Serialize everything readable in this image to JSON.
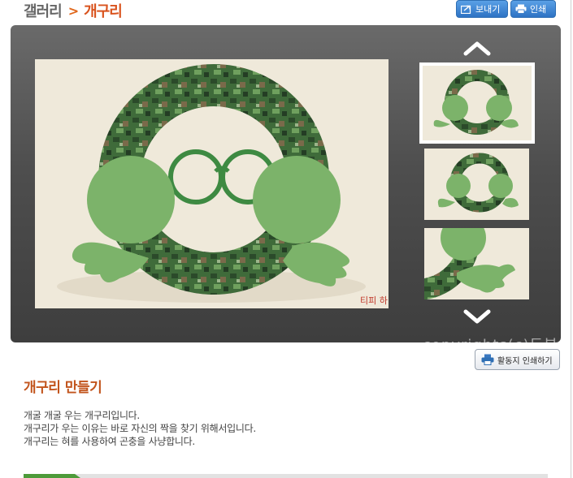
{
  "header": {
    "breadcrumb_parent": "갤러리",
    "breadcrumb_separator": ">",
    "breadcrumb_current": "개구리",
    "send_label": "보내기",
    "print_label": "인쇄"
  },
  "viewer": {
    "watermark": "copyrights(c)도부"
  },
  "activity_print_label": "활동지 인쇄하기",
  "content": {
    "title": "개구리 만들기",
    "lines": [
      "개굴 개굴 우는 개구리입니다.",
      "개구리가 우는 이유는 바로 자신의 짝을 찾기 위해서입니다.",
      "개구리는 혀를 사용하여 곤충을 사냥합니다."
    ]
  },
  "colors": {
    "accent_orange": "#d9531e",
    "button_blue": "#2e73c4",
    "viewer_gray": "#4e4e4e",
    "frog_green": "#7cb36a"
  },
  "icons": [
    "send-icon",
    "printer-icon",
    "chevron-up-icon",
    "chevron-down-icon",
    "printer-activity-icon"
  ]
}
